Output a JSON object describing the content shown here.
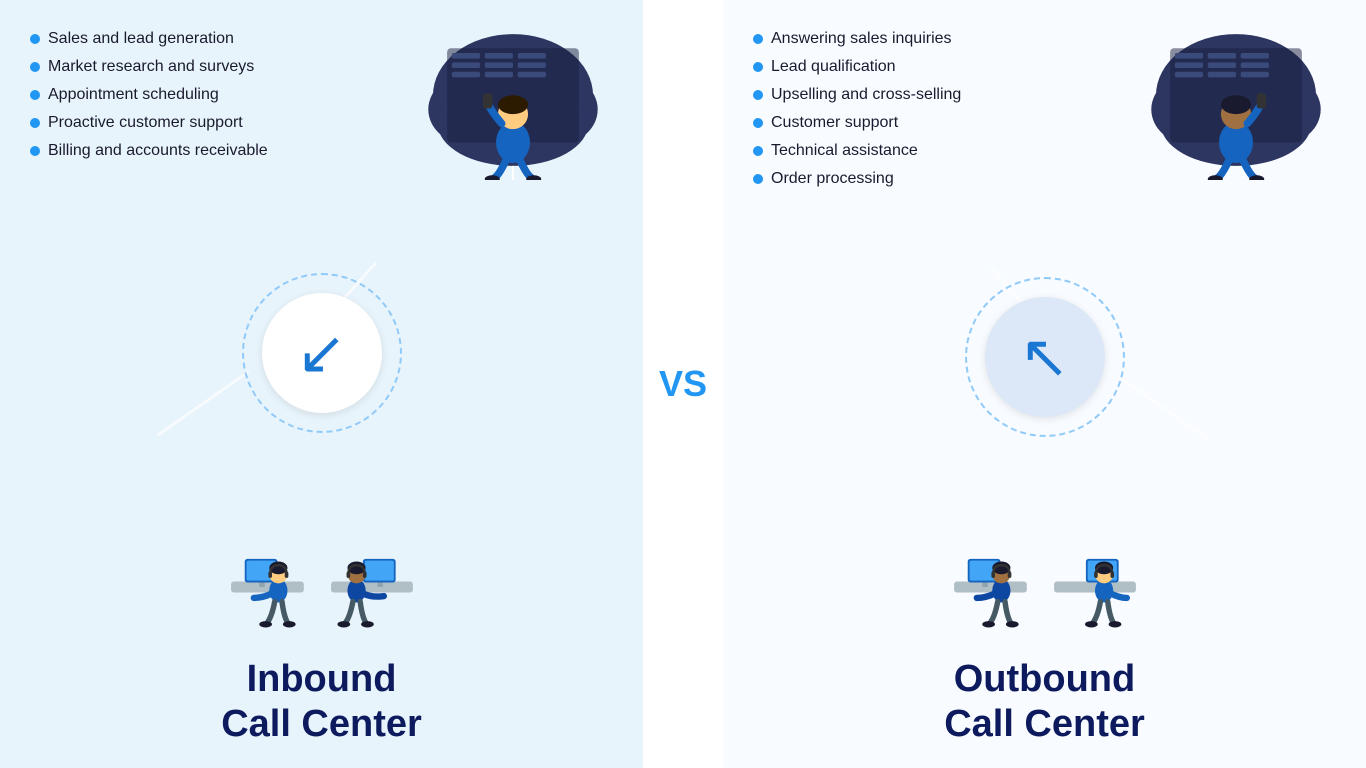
{
  "left": {
    "title_line1": "Inbound",
    "title_line2": "Call Center",
    "bullet_items": [
      "Sales and lead generation",
      "Market research and surveys",
      "Appointment scheduling",
      "Proactive customer support",
      "Billing and accounts receivable"
    ],
    "arrow_char": "↙",
    "arrow_direction": "inbound"
  },
  "right": {
    "title_line1": "Outbound",
    "title_line2": "Call Center",
    "bullet_items": [
      "Answering sales inquiries",
      "Lead qualification",
      "Upselling and cross-selling",
      "Customer support",
      "Technical assistance",
      "Order processing"
    ],
    "arrow_char": "↖",
    "arrow_direction": "outbound"
  },
  "vs_label": "VS",
  "accent_color": "#2196f3",
  "title_color": "#0d1b5e",
  "bullet_color": "#2196f3",
  "bg_left": "#e8f4fb",
  "bg_right": "#f8fbff"
}
